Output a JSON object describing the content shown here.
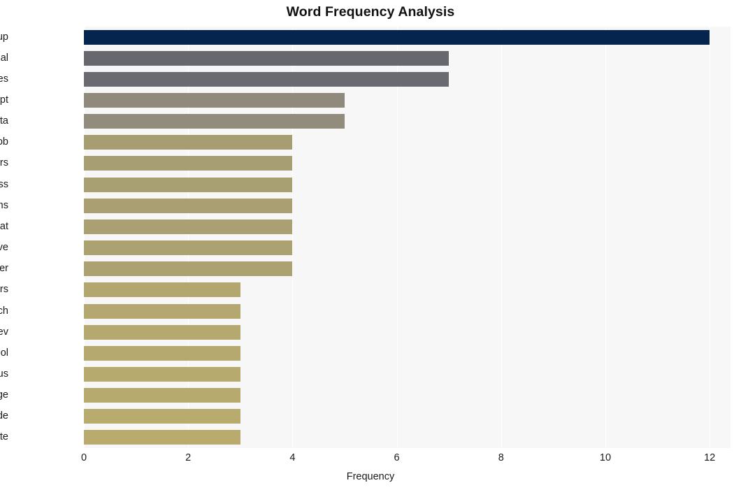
{
  "chart_data": {
    "type": "bar",
    "orientation": "horizontal",
    "title": "Word Frequency Analysis",
    "xlabel": "Frequency",
    "ylabel": "",
    "xlim": [
      0,
      12.4
    ],
    "xticks": [
      0,
      2,
      4,
      6,
      8,
      10,
      12
    ],
    "grid": true,
    "grid_axis": "x",
    "legend": "none",
    "categories": [
      "group",
      "steal",
      "websites",
      "script",
      "data",
      "job",
      "actors",
      "xss",
      "victims",
      "threat",
      "believe",
      "server",
      "resumelooters",
      "search",
      "rostovcev",
      "tool",
      "malicious",
      "page",
      "code",
      "execute"
    ],
    "values": [
      12,
      7,
      7,
      5,
      5,
      4,
      4,
      4,
      4,
      4,
      4,
      4,
      3,
      3,
      3,
      3,
      3,
      3,
      3,
      3
    ],
    "bar_colors": [
      "#06254e",
      "#67676e",
      "#6a6a71",
      "#8f8a7b",
      "#918c7c",
      "#a69d73",
      "#a79e73",
      "#a89f73",
      "#a99f72",
      "#aaa072",
      "#aba171",
      "#aca271",
      "#b3a770",
      "#b4a870",
      "#b5a96f",
      "#b6a96f",
      "#b7aa6e",
      "#b7aa6e",
      "#b8ab6e",
      "#b8ab6d"
    ],
    "plot_background": "#f7f7f7",
    "gridline_color": "#ffffff",
    "figure_background": "#ffffff"
  }
}
